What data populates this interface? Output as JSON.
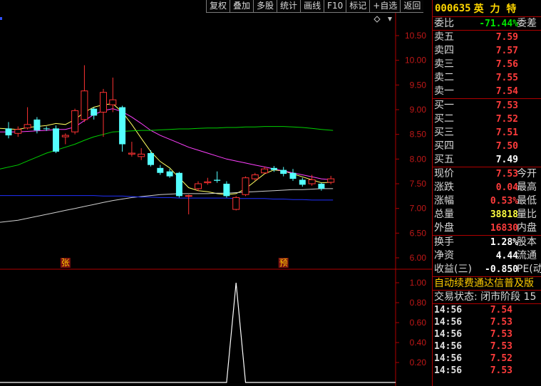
{
  "toolbar": [
    "复权",
    "叠加",
    "多股",
    "统计",
    "画线",
    "F10",
    "标记",
    "+自选",
    "返回"
  ],
  "stock": {
    "code": "000635",
    "name": "英 力 特"
  },
  "weibi": {
    "label": "委比",
    "value": "-71.44%",
    "right": "委差"
  },
  "asks": [
    {
      "label": "卖五",
      "price": "7.59"
    },
    {
      "label": "卖四",
      "price": "7.57"
    },
    {
      "label": "卖三",
      "price": "7.56"
    },
    {
      "label": "卖二",
      "price": "7.55"
    },
    {
      "label": "卖一",
      "price": "7.54"
    }
  ],
  "bids": [
    {
      "label": "买一",
      "price": "7.53"
    },
    {
      "label": "买二",
      "price": "7.52"
    },
    {
      "label": "买三",
      "price": "7.51"
    },
    {
      "label": "买四",
      "price": "7.50"
    },
    {
      "label": "买五",
      "price": "7.49"
    }
  ],
  "quote": [
    {
      "label": "现价",
      "value": "7.53",
      "color": "red",
      "right": "今开"
    },
    {
      "label": "涨跌",
      "value": "0.04",
      "color": "red",
      "right": "最高"
    },
    {
      "label": "涨幅",
      "value": "0.53%",
      "color": "red",
      "right": "最低"
    },
    {
      "label": "总量",
      "value": "38818",
      "color": "yellow",
      "right": "量比"
    },
    {
      "label": "外盘",
      "value": "16830",
      "color": "red",
      "right": "内盘"
    }
  ],
  "fundamentals": [
    {
      "label": "换手",
      "value": "1.28%",
      "right": "股本"
    },
    {
      "label": "净资",
      "value": "4.44",
      "right": "流通"
    },
    {
      "label": "收益(三)",
      "value": "-0.850",
      "right": "PE(动"
    }
  ],
  "notice": "自动续费通达信普及版",
  "status": "交易状态: 闭市阶段 15",
  "ticks": [
    {
      "time": "14:56",
      "price": "7.54"
    },
    {
      "time": "14:56",
      "price": "7.53"
    },
    {
      "time": "14:56",
      "price": "7.53"
    },
    {
      "time": "14:56",
      "price": "7.53"
    },
    {
      "time": "14:56",
      "price": "7.52"
    },
    {
      "time": "14:56",
      "price": "7.53"
    }
  ],
  "markers": {
    "zhang": "张",
    "yu": "预"
  },
  "chart_data": {
    "type": "candlestick",
    "price_axis": [
      "10.50",
      "10.00",
      "9.50",
      "9.00",
      "8.50",
      "8.00",
      "7.50",
      "7.00",
      "6.50",
      "6.00"
    ],
    "ind_axis": [
      "1.00",
      "0.80",
      "0.60",
      "0.40",
      "0.20"
    ],
    "candles": [
      {
        "o": 8.62,
        "c": 8.48,
        "h": 8.75,
        "l": 8.42
      },
      {
        "o": 8.52,
        "c": 8.6,
        "h": 8.66,
        "l": 8.45
      },
      {
        "o": 8.63,
        "c": 8.7,
        "h": 9.05,
        "l": 8.6
      },
      {
        "o": 8.8,
        "c": 8.58,
        "h": 8.85,
        "l": 8.52
      },
      {
        "o": 8.62,
        "c": 8.61,
        "h": 8.66,
        "l": 8.57
      },
      {
        "o": 8.62,
        "c": 8.15,
        "h": 8.68,
        "l": 8.12
      },
      {
        "o": 8.45,
        "c": 8.48,
        "h": 8.52,
        "l": 8.3
      },
      {
        "o": 8.55,
        "c": 8.98,
        "h": 9.02,
        "l": 8.5
      },
      {
        "o": 8.8,
        "c": 9.38,
        "h": 9.9,
        "l": 8.75
      },
      {
        "o": 9.02,
        "c": 8.88,
        "h": 9.05,
        "l": 8.8
      },
      {
        "o": 8.95,
        "c": 9.35,
        "h": 9.42,
        "l": 8.45
      },
      {
        "o": 9.1,
        "c": 9.2,
        "h": 9.65,
        "l": 8.95
      },
      {
        "o": 9.05,
        "c": 8.3,
        "h": 9.08,
        "l": 8.15
      },
      {
        "o": 8.1,
        "c": 8.12,
        "h": 8.35,
        "l": 8.05
      },
      {
        "o": 8.05,
        "c": 8.1,
        "h": 8.22,
        "l": 7.98
      },
      {
        "o": 8.12,
        "c": 7.88,
        "h": 8.18,
        "l": 7.85
      },
      {
        "o": 7.82,
        "c": 7.72,
        "h": 7.88,
        "l": 7.68
      },
      {
        "o": 7.75,
        "c": 7.65,
        "h": 7.8,
        "l": 7.62
      },
      {
        "o": 7.72,
        "c": 7.25,
        "h": 7.74,
        "l": 7.22
      },
      {
        "o": 7.25,
        "c": 7.26,
        "h": 7.28,
        "l": 6.88
      },
      {
        "o": 7.4,
        "c": 7.5,
        "h": 7.55,
        "l": 7.35
      },
      {
        "o": 7.52,
        "c": 7.54,
        "h": 7.62,
        "l": 7.48
      },
      {
        "o": 7.58,
        "c": 7.56,
        "h": 7.75,
        "l": 7.52
      },
      {
        "o": 7.5,
        "c": 7.25,
        "h": 7.55,
        "l": 7.22
      },
      {
        "o": 6.98,
        "c": 7.22,
        "h": 7.25,
        "l": 6.96
      },
      {
        "o": 7.28,
        "c": 7.62,
        "h": 7.65,
        "l": 7.25
      },
      {
        "o": 7.6,
        "c": 7.68,
        "h": 7.72,
        "l": 7.56
      },
      {
        "o": 7.72,
        "c": 7.8,
        "h": 7.85,
        "l": 7.7
      },
      {
        "o": 7.82,
        "c": 7.78,
        "h": 7.86,
        "l": 7.74
      },
      {
        "o": 7.78,
        "c": 7.7,
        "h": 7.84,
        "l": 7.65
      },
      {
        "o": 7.72,
        "c": 7.6,
        "h": 7.8,
        "l": 7.56
      },
      {
        "o": 7.58,
        "c": 7.48,
        "h": 7.62,
        "l": 7.44
      },
      {
        "o": 7.5,
        "c": 7.58,
        "h": 7.68,
        "l": 7.46
      },
      {
        "o": 7.5,
        "c": 7.4,
        "h": 7.52,
        "l": 7.36
      },
      {
        "o": 7.53,
        "c": 7.6,
        "h": 7.66,
        "l": 7.49
      }
    ],
    "ma_lines": [
      {
        "name": "ma5",
        "color": "#ffff60",
        "values": [
          8.62,
          8.6,
          8.64,
          8.66,
          8.68,
          8.72,
          8.7,
          8.8,
          8.95,
          9.05,
          9.1,
          9.12,
          8.95,
          8.7,
          8.42,
          8.15,
          7.95,
          7.82,
          7.62,
          7.42,
          7.36,
          7.34,
          7.3,
          7.28,
          7.3,
          7.4,
          7.55,
          7.7,
          7.78,
          7.76,
          7.7,
          7.64,
          7.58,
          7.52,
          7.53
        ]
      },
      {
        "name": "ma10",
        "color": "#ff40ff",
        "values": [
          8.55,
          8.55,
          8.56,
          8.57,
          8.58,
          8.6,
          8.6,
          8.65,
          8.78,
          8.9,
          8.98,
          9.02,
          8.96,
          8.85,
          8.72,
          8.58,
          8.48,
          8.4,
          8.32,
          8.24,
          8.18,
          8.12,
          8.06,
          8.0,
          7.96,
          7.92,
          7.88,
          7.84,
          7.8,
          7.76,
          7.72,
          7.68,
          7.64,
          7.6,
          7.58
        ]
      },
      {
        "name": "ma20",
        "color": "#00d000",
        "values": [
          7.8,
          7.88,
          7.96,
          8.04,
          8.12,
          8.18,
          8.24,
          8.3,
          8.38,
          8.45,
          8.5,
          8.55,
          8.56,
          8.57,
          8.58,
          8.58,
          8.59,
          8.6,
          8.61,
          8.61,
          8.62,
          8.63,
          8.63,
          8.64,
          8.64,
          8.65,
          8.65,
          8.66,
          8.66,
          8.66,
          8.65,
          8.64,
          8.62,
          8.6,
          8.58
        ]
      },
      {
        "name": "ma30",
        "color": "#d0d0d0",
        "values": [
          6.72,
          6.76,
          6.8,
          6.84,
          6.88,
          6.92,
          6.96,
          7.0,
          7.04,
          7.08,
          7.12,
          7.16,
          7.19,
          7.22,
          7.24,
          7.26,
          7.28,
          7.29,
          7.3,
          7.3,
          7.3,
          7.3,
          7.31,
          7.31,
          7.32,
          7.33,
          7.34,
          7.35,
          7.36,
          7.37,
          7.38,
          7.38,
          7.39,
          7.4,
          7.4
        ]
      },
      {
        "name": "ma60",
        "color": "#2030ff",
        "values": [
          7.26,
          7.26,
          7.26,
          7.26,
          7.26,
          7.26,
          7.26,
          7.26,
          7.26,
          7.26,
          7.25,
          7.25,
          7.25,
          7.24,
          7.23,
          7.23,
          7.22,
          7.22,
          7.21,
          7.21,
          7.21,
          7.21,
          7.21,
          7.21,
          7.2,
          7.2,
          7.2,
          7.2,
          7.19,
          7.19,
          7.18,
          7.18,
          7.17,
          7.17,
          7.17
        ]
      }
    ],
    "indicator": [
      0,
      0,
      0,
      0,
      0,
      0,
      0,
      0,
      0,
      0,
      0,
      0,
      0,
      0,
      0,
      0,
      0,
      0,
      0,
      0,
      0,
      0,
      0,
      0,
      1,
      0,
      0,
      0,
      0,
      0,
      0,
      0,
      0,
      0,
      0
    ],
    "marker_positions": {
      "zhang": 6,
      "yu": 29
    }
  }
}
